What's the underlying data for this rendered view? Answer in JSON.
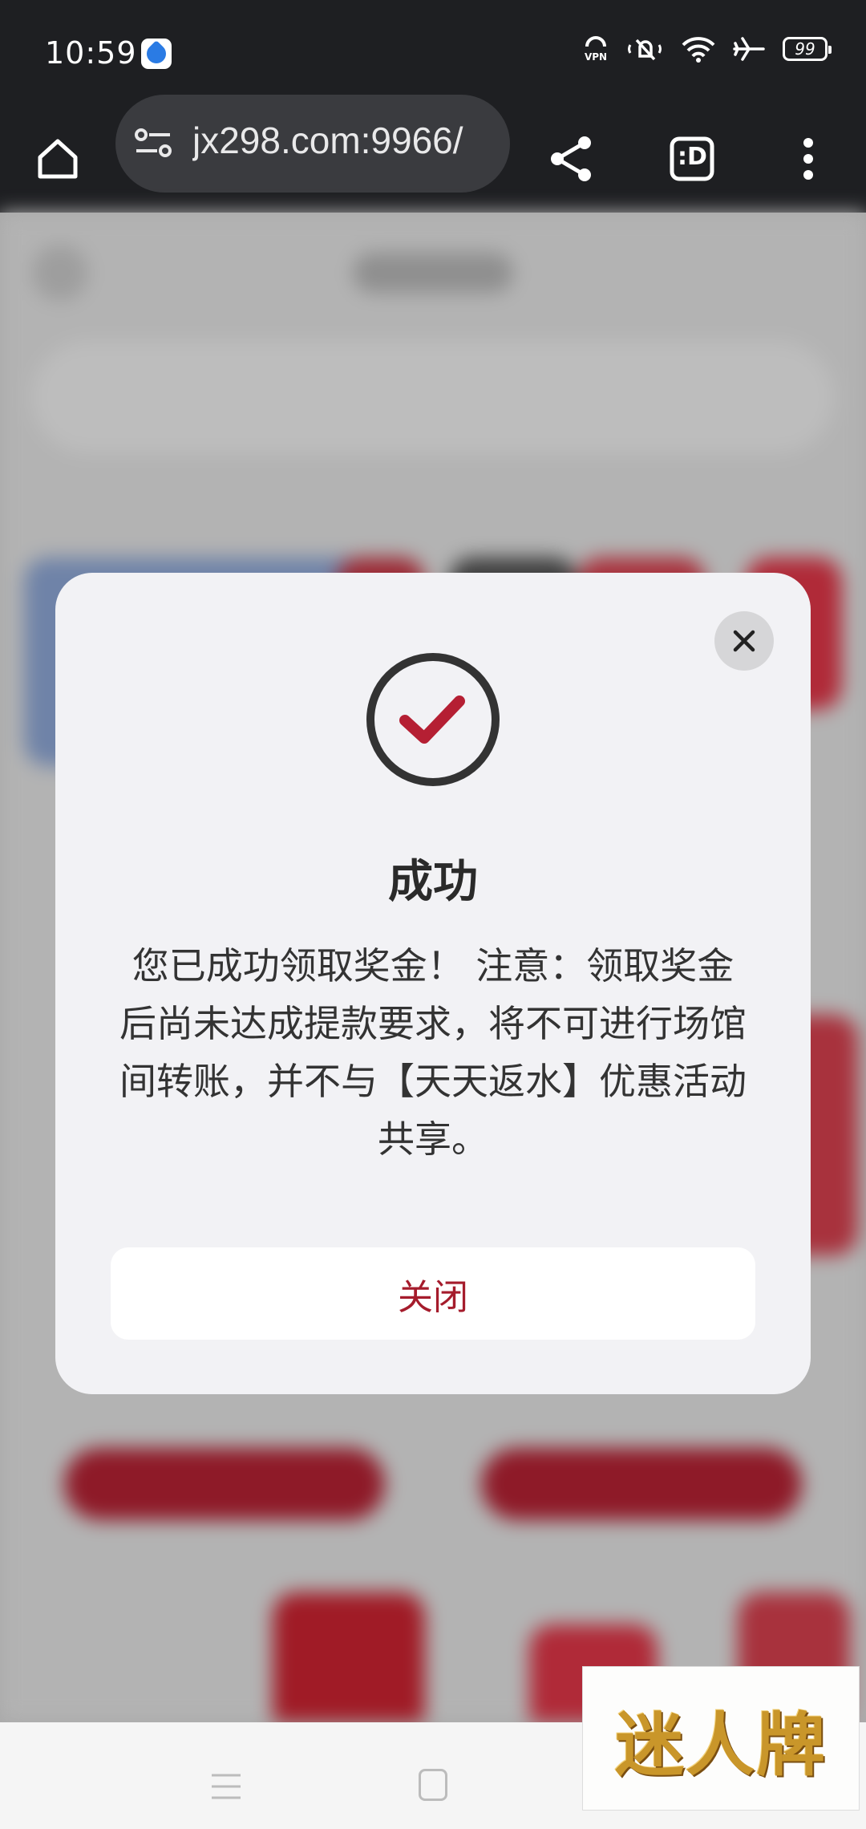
{
  "status_bar": {
    "time": "10:59",
    "battery": "99",
    "icons": [
      "app-icon",
      "vpn-icon",
      "mute-icon",
      "wifi-icon",
      "airplane-icon",
      "battery-icon"
    ]
  },
  "browser": {
    "url": "jx298.com:9966/",
    "icons": [
      "home-icon",
      "site-settings-icon",
      "share-icon",
      "tabs-icon",
      "more-icon"
    ],
    "tabs_label": ":D"
  },
  "dialog": {
    "title": "成功",
    "message": "您已成功领取奖金！ 注意：领取奖金后尚未达成提款要求，将不可进行场馆间转账，并不与【天天返水】优惠活动共享。",
    "close_button_label": "关闭",
    "accent_color": "#b51f33"
  },
  "watermark": {
    "text": "迷人牌"
  }
}
